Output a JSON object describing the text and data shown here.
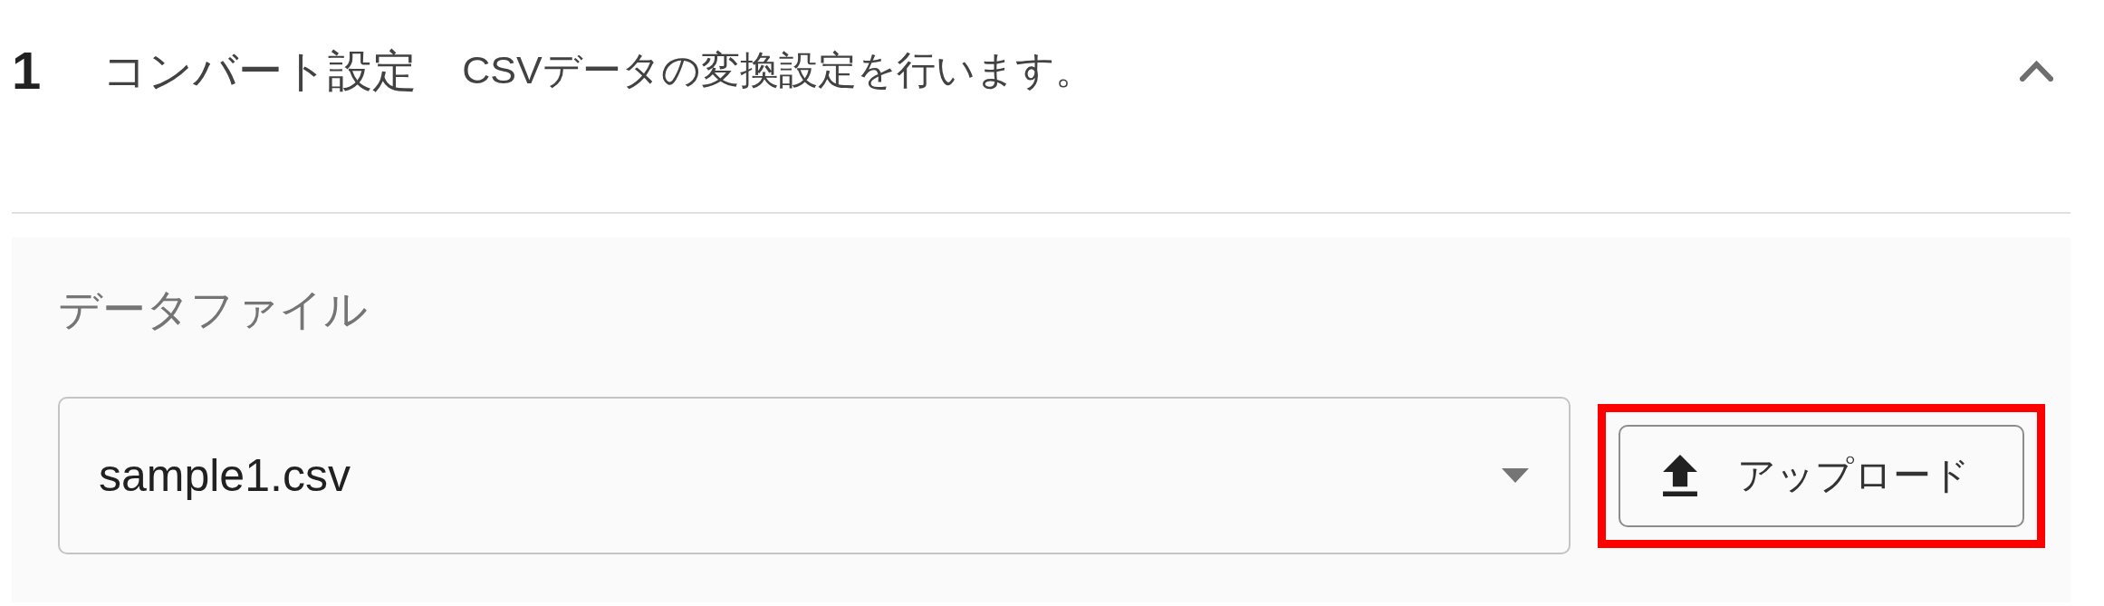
{
  "section": {
    "number": "1",
    "title": "コンバート設定",
    "description": "CSVデータの変換設定を行います。",
    "expanded": true
  },
  "data_file": {
    "label": "データファイル",
    "select": {
      "value": "sample1.csv"
    },
    "upload_button": {
      "label": "アップロード",
      "highlighted": true
    }
  }
}
